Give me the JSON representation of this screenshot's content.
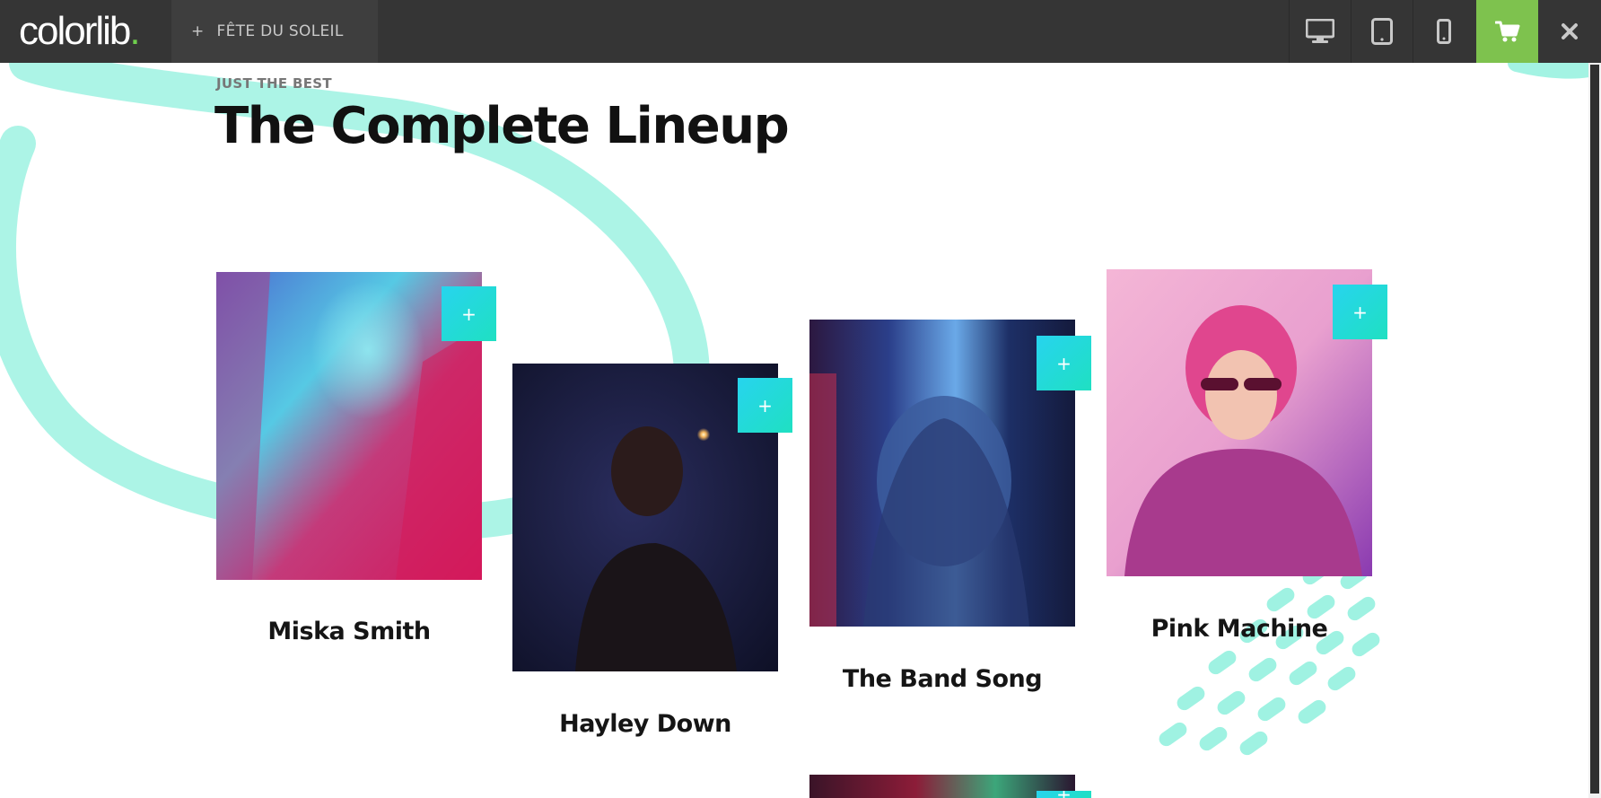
{
  "topbar": {
    "logo_text": "colorlib",
    "logo_dot": ".",
    "theme_tab_plus": "+",
    "theme_tab_label": "FÊTE DU SOLEIL",
    "buttons": [
      "desktop-icon",
      "tablet-icon",
      "mobile-icon",
      "cart-icon",
      "close-icon"
    ],
    "accent_color": "#7ec24e"
  },
  "section": {
    "eyebrow": "JUST THE BEST",
    "title": "The Complete Lineup"
  },
  "lineup": [
    {
      "name": "Miska Smith",
      "plus": "+"
    },
    {
      "name": "Hayley Down",
      "plus": "+"
    },
    {
      "name": "The Band Song",
      "plus": "+"
    },
    {
      "name": "Pink Machine",
      "plus": "+"
    },
    {
      "name": "",
      "plus": "+"
    }
  ],
  "colors": {
    "aqua_accent": "#27d4ee",
    "mint_decoration": "#7fefd9"
  }
}
